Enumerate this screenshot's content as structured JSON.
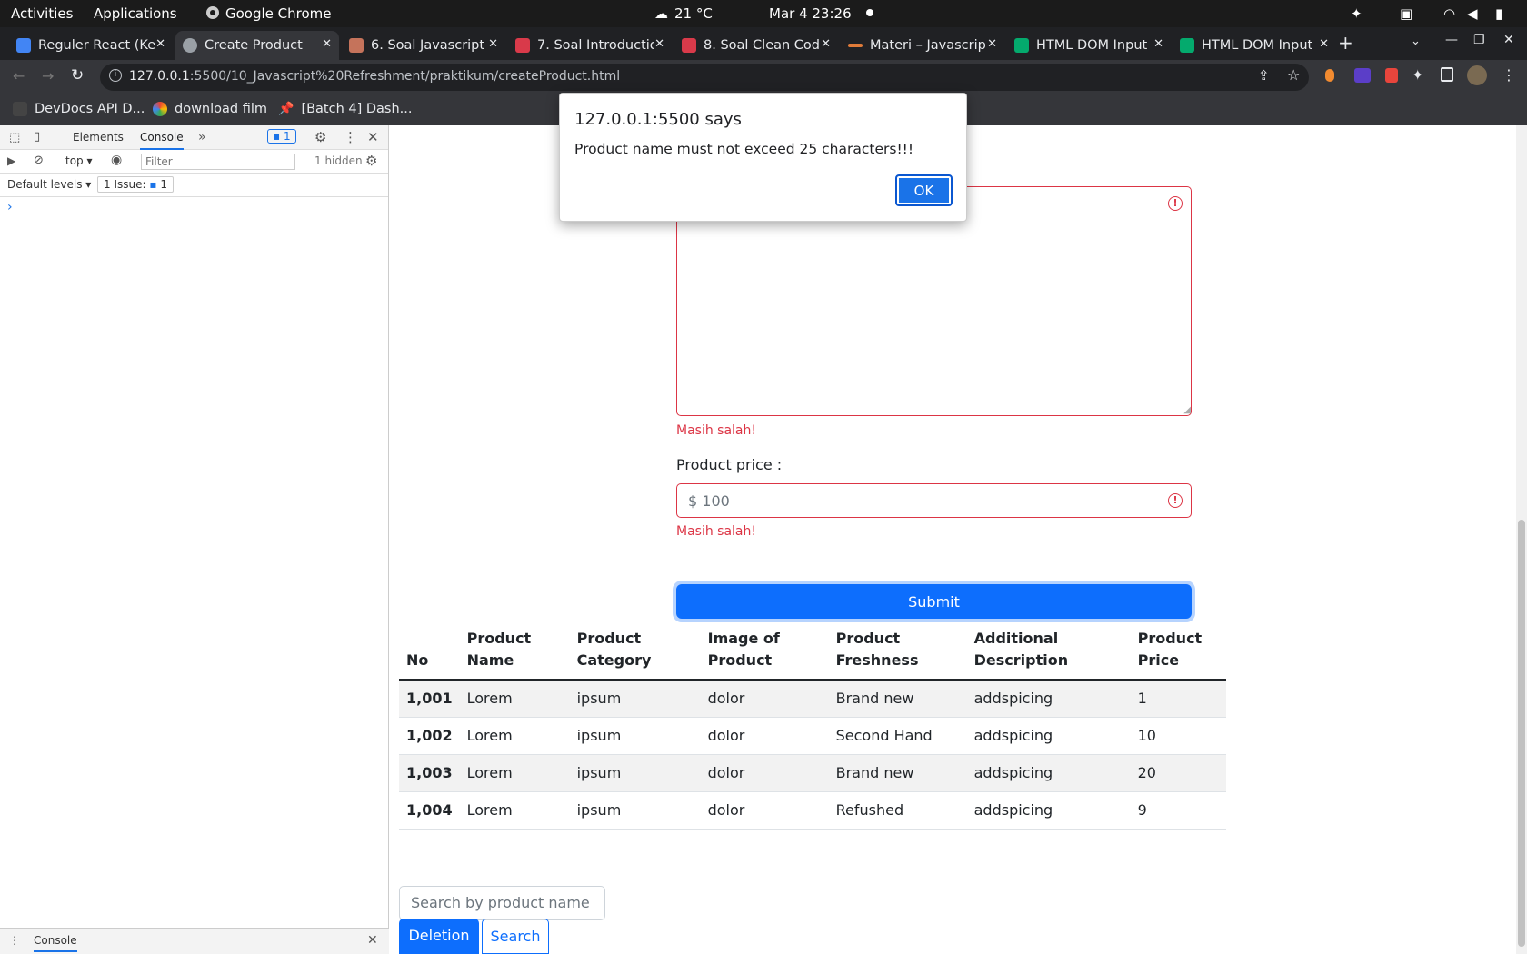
{
  "system_bar": {
    "activities": "Activities",
    "applications": "Applications",
    "app_name": "Google Chrome",
    "weather": "21 °C",
    "datetime": "Mar 4  23:26"
  },
  "tabs": [
    {
      "label": "Reguler React (Ke",
      "color": "#4285f4"
    },
    {
      "label": "Create Product",
      "color": "#9aa0a6"
    },
    {
      "label": "6. Soal Javascript",
      "color": "#c5735b"
    },
    {
      "label": "7. Soal Introductio",
      "color": "#d93a4a"
    },
    {
      "label": "8. Soal Clean Code",
      "color": "#d93a4a"
    },
    {
      "label": "Materi – Javascrip",
      "color": "#e07b39"
    },
    {
      "label": "HTML DOM Input",
      "color": "#04aa6d"
    },
    {
      "label": "HTML DOM Input",
      "color": "#04aa6d"
    }
  ],
  "address_bar": {
    "url_host": "127.0.0.1",
    "url_path": ":5500/10_Javascript%20Refreshment/praktikum/createProduct.html"
  },
  "bookmarks": [
    {
      "label": "DevDocs API D..."
    },
    {
      "label": "download film"
    },
    {
      "label": "[Batch 4] Dash..."
    }
  ],
  "devtools": {
    "tab_elements": "Elements",
    "tab_console": "Console",
    "issues_badge": "1",
    "context": "top",
    "filter_placeholder": "Filter",
    "hidden_count": "1 hidden",
    "levels": "Default levels",
    "issue_label": "1 Issue:",
    "issue_count": "1",
    "prompt": "›",
    "drawer_tab": "Console"
  },
  "alert": {
    "title": "127.0.0.1:5500 says",
    "message": "Product name must not exceed 25 characters!!!",
    "ok": "OK"
  },
  "form": {
    "description_error": "Masih salah!",
    "price_label": "Product price :",
    "price_placeholder": "$ 100",
    "price_error": "Masih salah!",
    "submit": "Submit"
  },
  "table": {
    "headers": [
      "No",
      "Product Name",
      "Product Category",
      "Image of Product",
      "Product Freshness",
      "Additional Description",
      "Product Price"
    ],
    "rows": [
      [
        "1,001",
        "Lorem",
        "ipsum",
        "dolor",
        "Brand new",
        "addspicing",
        "1"
      ],
      [
        "1,002",
        "Lorem",
        "ipsum",
        "dolor",
        "Second Hand",
        "addspicing",
        "10"
      ],
      [
        "1,003",
        "Lorem",
        "ipsum",
        "dolor",
        "Brand new",
        "addspicing",
        "20"
      ],
      [
        "1,004",
        "Lorem",
        "ipsum",
        "dolor",
        "Refushed",
        "addspicing",
        "9"
      ]
    ]
  },
  "search": {
    "placeholder": "Search by product name",
    "deletion_button": "Deletion",
    "search_button": "Search"
  }
}
